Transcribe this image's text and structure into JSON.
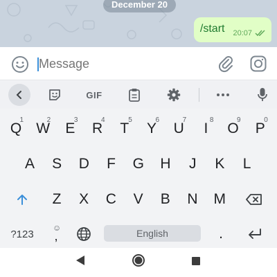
{
  "chat": {
    "date_label": "December 20",
    "message": {
      "text": "/start",
      "time": "20:07",
      "status_icon": "double-check-icon"
    }
  },
  "input": {
    "placeholder": "Message",
    "left_icon": "emoji-icon",
    "right_icons": [
      "attach-icon",
      "camera-icon"
    ]
  },
  "keyboard": {
    "toolbar": [
      "back-chevron-icon",
      "sticker-icon",
      "GIF",
      "clipboard-icon",
      "gear-icon",
      "more-icon",
      "mic-icon"
    ],
    "row1": [
      {
        "key": "Q",
        "hint": "1"
      },
      {
        "key": "W",
        "hint": "2"
      },
      {
        "key": "E",
        "hint": "3"
      },
      {
        "key": "R",
        "hint": "4"
      },
      {
        "key": "T",
        "hint": "5"
      },
      {
        "key": "Y",
        "hint": "6"
      },
      {
        "key": "U",
        "hint": "7"
      },
      {
        "key": "I",
        "hint": "8"
      },
      {
        "key": "O",
        "hint": "9"
      },
      {
        "key": "P",
        "hint": "0"
      }
    ],
    "row2": [
      "A",
      "S",
      "D",
      "F",
      "G",
      "H",
      "J",
      "K",
      "L"
    ],
    "row3": [
      "Z",
      "X",
      "C",
      "V",
      "B",
      "N",
      "M"
    ],
    "row4": {
      "symbols": "?123",
      "comma_hint": "☺",
      "comma": ",",
      "space": "English",
      "period": "."
    },
    "colors": {
      "accent": "#3b8fd9"
    }
  }
}
